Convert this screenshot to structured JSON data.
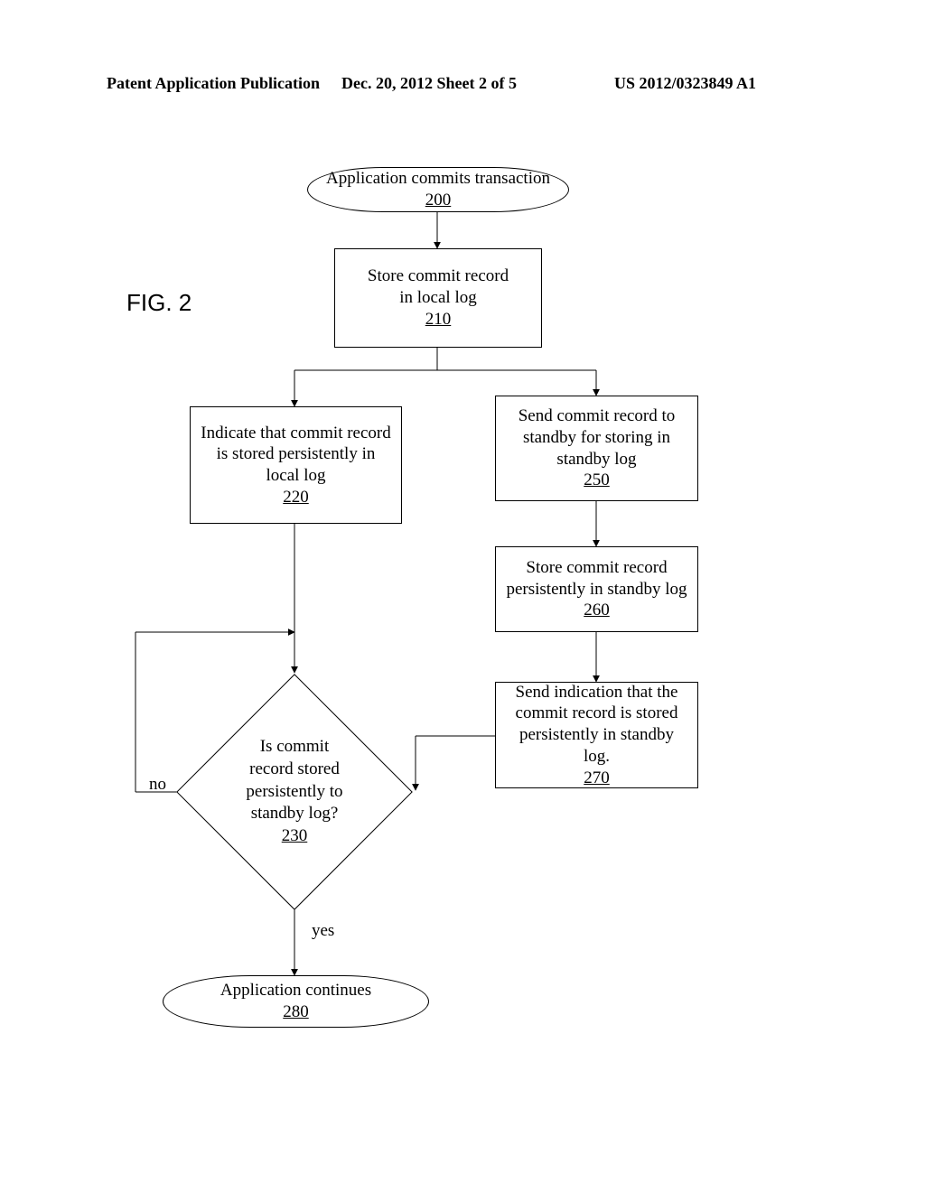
{
  "header": {
    "left": "Patent Application Publication",
    "mid": "Dec. 20, 2012  Sheet 2 of 5",
    "right": "US 2012/0323849 A1"
  },
  "figure_label": "FIG. 2",
  "nodes": {
    "n200": {
      "text": "Application commits transaction",
      "ref": "200"
    },
    "n210": {
      "text": "Store commit record\nin local log",
      "ref": "210"
    },
    "n220": {
      "text": "Indicate that commit record\nis stored persistently in\nlocal log",
      "ref": "220"
    },
    "n250": {
      "text": "Send commit record to\nstandby for storing in\nstandby log",
      "ref": "250"
    },
    "n260": {
      "text": "Store commit record\npersistently in standby log",
      "ref": "260"
    },
    "n270": {
      "text": "Send indication that the\ncommit record is stored\npersistently in standby log.",
      "ref": "270"
    },
    "n230": {
      "text": "Is commit\nrecord stored\npersistently to\nstandby log?",
      "ref": "230"
    },
    "n280": {
      "text": "Application continues",
      "ref": "280"
    }
  },
  "edges": {
    "no": "no",
    "yes": "yes"
  },
  "chart_data": {
    "type": "flowchart",
    "nodes": [
      {
        "id": "200",
        "shape": "terminator",
        "text": "Application commits transaction"
      },
      {
        "id": "210",
        "shape": "process",
        "text": "Store commit record in local log"
      },
      {
        "id": "220",
        "shape": "process",
        "text": "Indicate that commit record is stored persistently in local log"
      },
      {
        "id": "250",
        "shape": "process",
        "text": "Send commit record to standby for storing in standby log"
      },
      {
        "id": "260",
        "shape": "process",
        "text": "Store commit record persistently in standby log"
      },
      {
        "id": "270",
        "shape": "process",
        "text": "Send indication that the commit record is stored persistently in standby log."
      },
      {
        "id": "230",
        "shape": "decision",
        "text": "Is commit record stored persistently to standby log?"
      },
      {
        "id": "280",
        "shape": "terminator",
        "text": "Application continues"
      }
    ],
    "edges": [
      {
        "from": "200",
        "to": "210"
      },
      {
        "from": "210",
        "to": "220"
      },
      {
        "from": "210",
        "to": "250"
      },
      {
        "from": "220",
        "to": "230"
      },
      {
        "from": "250",
        "to": "260"
      },
      {
        "from": "260",
        "to": "270"
      },
      {
        "from": "270",
        "to": "230"
      },
      {
        "from": "230",
        "to": "230",
        "label": "no"
      },
      {
        "from": "230",
        "to": "280",
        "label": "yes"
      }
    ]
  }
}
